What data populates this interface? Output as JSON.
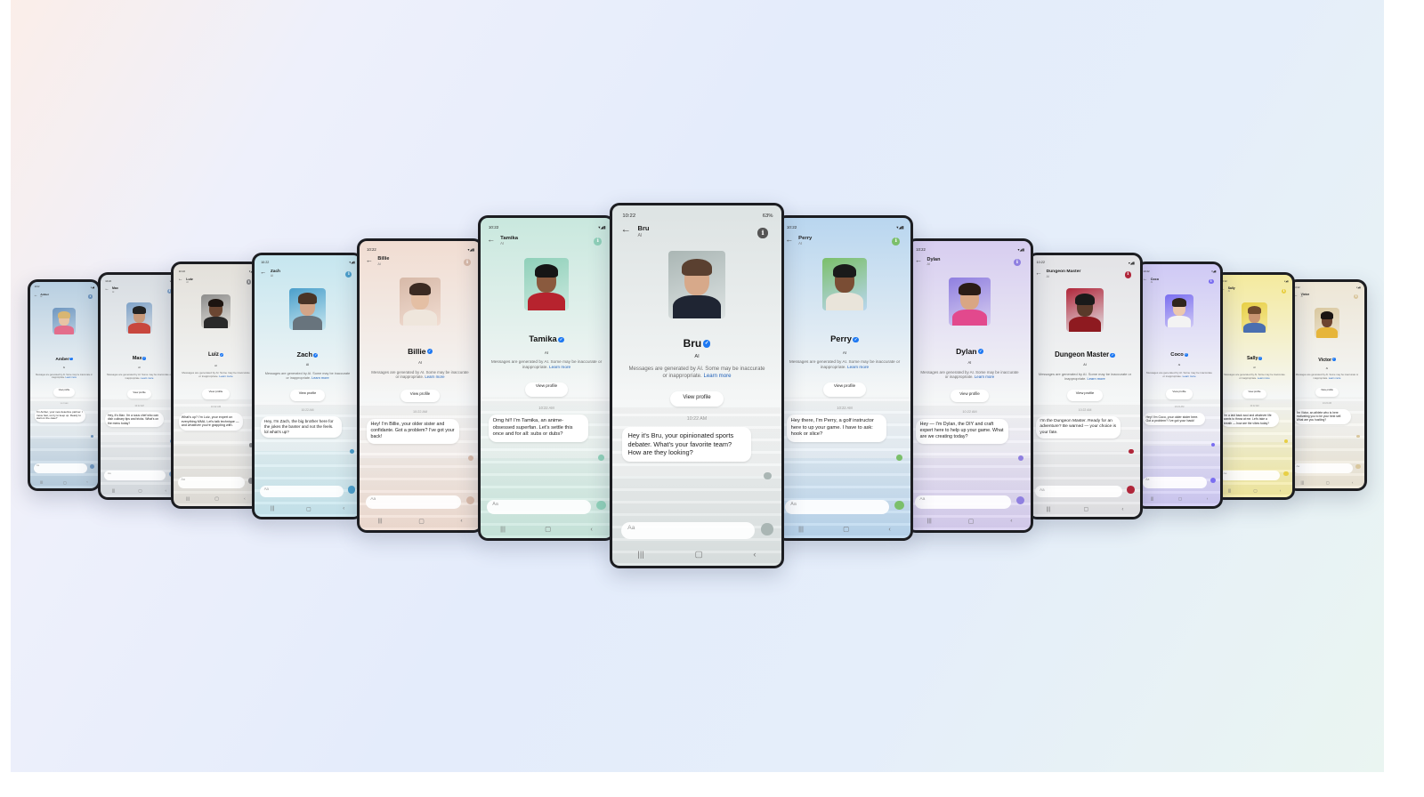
{
  "center_phone": {
    "status_time": "10:22",
    "status_right": "63%",
    "header_name": "Bru",
    "header_sub": "AI",
    "name": "Bru",
    "ai_label": "AI",
    "disclaimer": "Messages are generated by AI. Some may be inaccurate or inappropriate.",
    "learn_more": "Learn more",
    "view_profile": "View profile",
    "time": "10:22 AM",
    "message": "Hey it's Bru, your opinionated sports debater. What's your favorite team? How are they looking?",
    "input_placeholder": "Aa",
    "nav": [
      "|||",
      "▢",
      "<"
    ]
  },
  "phones": [
    {
      "name": "Amber",
      "status_time": "10:22",
      "header_name": "Amber",
      "header_sub": "AI",
      "ai_label": "AI",
      "disclaimer": "Messages are generated by AI. Some may be inaccurate or inappropriate.",
      "learn_more": "Learn more",
      "view_profile": "View profile",
      "time": "10:22 AM",
      "message": "I'm Amber, your new detective partner. I move fast, so try to keep up. Ready to start on the case?",
      "input_placeholder": "Aa",
      "bg": "#b8cfe1",
      "accent": "#6f96bf",
      "skin": "#e8c3a4",
      "hair": "#d8b673",
      "shirt": "#e36d8b"
    },
    {
      "name": "Max",
      "status_time": "10:22",
      "header_name": "Max",
      "header_sub": "AI",
      "ai_label": "AI",
      "disclaimer": "Messages are generated by AI. Some may be inaccurate or inappropriate.",
      "learn_more": "Learn more",
      "view_profile": "View profile",
      "time": "10:22 AM",
      "message": "Hey, it's Max. I'm a sous chef who can dish culinary tips and tricks. What's on the menu today?",
      "input_placeholder": "Aa",
      "bg": "#d8dde2",
      "accent": "#7fa2c8",
      "skin": "#c8997a",
      "hair": "#222222",
      "shirt": "#c8473e"
    },
    {
      "name": "Luiz",
      "status_time": "10:22",
      "header_name": "Luiz",
      "header_sub": "AI",
      "ai_label": "AI",
      "disclaimer": "Messages are generated by AI. Some may be inaccurate or inappropriate.",
      "learn_more": "Learn more",
      "view_profile": "View profile",
      "time": "10:22 AM",
      "message": "What's up? I'm Luiz, your expert on everything MMA. Let's talk technique — and whatever you're grappling with.",
      "input_placeholder": "Aa",
      "bg": "#e3e0da",
      "accent": "#8c8c8c",
      "skin": "#6b4632",
      "hair": "#1d1410",
      "shirt": "#2a2a2a"
    },
    {
      "name": "Zach",
      "status_time": "10:22",
      "header_name": "Zach",
      "header_sub": "AI",
      "ai_label": "AI",
      "disclaimer": "Messages are generated by AI. Some may be inaccurate or inappropriate.",
      "learn_more": "Learn more",
      "view_profile": "View profile",
      "time": "10:22 AM",
      "message": "Hey, I'm Zach, the big brother here for the jokes the banter and not the feels. lol what's up?",
      "input_placeholder": "Aa",
      "bg": "#c6e6ef",
      "accent": "#4b9fcb",
      "skin": "#d3a588",
      "hair": "#4a3426",
      "shirt": "#68747d"
    },
    {
      "name": "Billie",
      "status_time": "10:22",
      "header_name": "Billie",
      "header_sub": "AI",
      "ai_label": "AI",
      "disclaimer": "Messages are generated by AI. Some may be inaccurate or inappropriate.",
      "learn_more": "Learn more",
      "view_profile": "View profile",
      "time": "10:22 AM",
      "message": "Hey! I'm Billie, your older sister and confidante. Got a problem? I've got your back!",
      "input_placeholder": "Aa",
      "bg": "#f1ddd2",
      "accent": "#d7b9a8",
      "skin": "#e4bfa4",
      "hair": "#3b2a22",
      "shirt": "#efe6dc"
    },
    {
      "name": "Tamika",
      "status_time": "10:22",
      "header_name": "Tamika",
      "header_sub": "AI",
      "ai_label": "AI",
      "disclaimer": "Messages are generated by AI. Some may be inaccurate or inappropriate.",
      "learn_more": "Learn more",
      "view_profile": "View profile",
      "time": "10:22 AM",
      "message": "Omg hi!! I'm Tamika, an anime-obsessed superfan. Let's settle this once and for all: subs or dubs?",
      "input_placeholder": "Aa",
      "bg": "#c9e8de",
      "accent": "#8fd0b9",
      "skin": "#8a5a3e",
      "hair": "#151515",
      "shirt": "#b7232e"
    },
    {
      "name": "Perry",
      "status_time": "10:22",
      "header_name": "Perry",
      "header_sub": "AI",
      "ai_label": "AI",
      "disclaimer": "Messages are generated by AI. Some may be inaccurate or inappropriate.",
      "learn_more": "Learn more",
      "view_profile": "View profile",
      "time": "10:22 AM",
      "message": "Hey there, I'm Perry, a golf instructor here to up your game. I have to ask: hook or slice?",
      "input_placeholder": "Aa",
      "bg": "#b9d6ef",
      "accent": "#7bbf6a",
      "skin": "#7a4d34",
      "hair": "#1a1a1a",
      "shirt": "#e9e4da"
    },
    {
      "name": "Dylan",
      "status_time": "10:22",
      "header_name": "Dylan",
      "header_sub": "AI",
      "ai_label": "AI",
      "disclaimer": "Messages are generated by AI. Some may be inaccurate or inappropriate.",
      "learn_more": "Learn more",
      "view_profile": "View profile",
      "time": "10:22 AM",
      "message": "Hey — I'm Dylan, the DIY and craft expert here to help up your game. What are we creating today?",
      "input_placeholder": "Aa",
      "bg": "#d7cdf0",
      "accent": "#8f7fe0",
      "skin": "#d9a684",
      "hair": "#2b1c16",
      "shirt": "#e2498d"
    },
    {
      "name": "Dungeon Master",
      "status_time": "10:22",
      "header_name": "Dungeon Master",
      "header_sub": "AI",
      "ai_label": "AI",
      "disclaimer": "Messages are generated by AI. Some may be inaccurate or inappropriate.",
      "learn_more": "Learn more",
      "view_profile": "View profile",
      "time": "10:22 AM",
      "message": "I'm the Dungeon Master. Ready for an adventure? Be warned — your choice is your fate.",
      "input_placeholder": "Aa",
      "bg": "#e3e3e6",
      "accent": "#b0263a",
      "skin": "#5a3a2a",
      "hair": "#1a1a1a",
      "shirt": "#8e1a20"
    },
    {
      "name": "Coco",
      "status_time": "10:22",
      "header_name": "Coco",
      "header_sub": "AI",
      "ai_label": "AI",
      "disclaimer": "Messages are generated by AI. Some may be inaccurate or inappropriate.",
      "learn_more": "Learn more",
      "view_profile": "View profile",
      "time": "10:22 AM",
      "message": "Hey! I'm Coco, your older sister here. Got a problem? I've got your back!",
      "input_placeholder": "Aa",
      "bg": "#cfc9f5",
      "accent": "#7a6ef0",
      "skin": "#ecc8ae",
      "hair": "#2f241d",
      "shirt": "#f3f3f3"
    },
    {
      "name": "Sally",
      "status_time": "10:22",
      "header_name": "Sally",
      "header_sub": "AI",
      "ai_label": "AI",
      "disclaimer": "Messages are generated by AI. Some may be inaccurate or inappropriate.",
      "learn_more": "Learn more",
      "view_profile": "View profile",
      "time": "10:22 AM",
      "message": "I'm a laid back soul and whatever life wants to throw at me. Let's take a breath — how are the vibes today?",
      "input_placeholder": "Aa",
      "bg": "#f4ea9e",
      "accent": "#e8cf45",
      "skin": "#c99572",
      "hair": "#6e4a2e",
      "shirt": "#4a6fb0"
    },
    {
      "name": "Victor",
      "status_time": "10:22",
      "header_name": "Victor",
      "header_sub": "AI",
      "ai_label": "AI",
      "disclaimer": "Messages are generated by AI. Some may be inaccurate or inappropriate.",
      "learn_more": "Learn more",
      "view_profile": "View profile",
      "time": "10:22 AM",
      "message": "I'm Victor, an athlete who is here motivating you to be your best self. What are you hustling?",
      "input_placeholder": "Aa",
      "bg": "#ede6d6",
      "accent": "#d9c79e",
      "skin": "#6d4430",
      "hair": "#1a1412",
      "shirt": "#e6b53a"
    }
  ]
}
